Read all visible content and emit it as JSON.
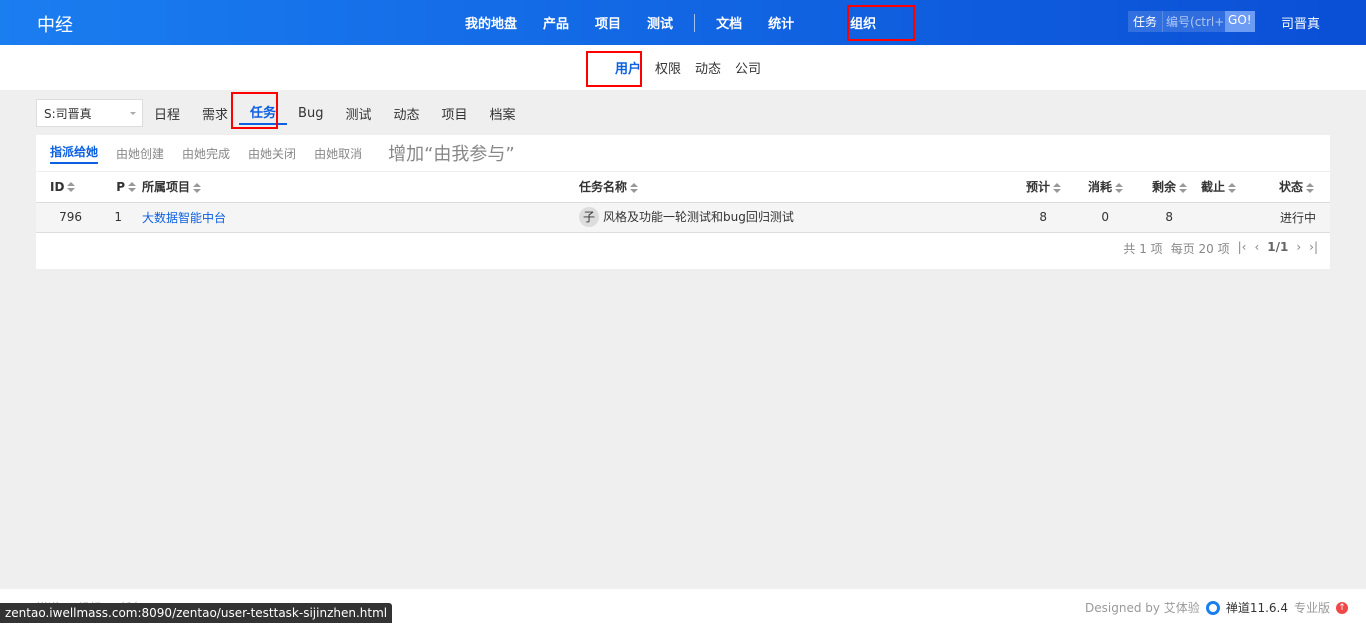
{
  "header": {
    "brand": "中经",
    "nav": [
      "我的地盘",
      "产品",
      "项目",
      "测试",
      "文档",
      "统计",
      "组织"
    ],
    "search_type": "任务",
    "search_placeholder": "编号(ctrl+g)",
    "go": "GO!",
    "user": "司晋真"
  },
  "subnav": [
    "用户",
    "权限",
    "动态",
    "公司"
  ],
  "toolbar": {
    "user_select": "S:司晋真",
    "items": [
      "日程",
      "需求",
      "任务",
      "Bug",
      "测试",
      "动态",
      "项目",
      "档案"
    ]
  },
  "tabs": [
    "指派给她",
    "由她创建",
    "由她完成",
    "由她关闭",
    "由她取消"
  ],
  "annotation": "增加“由我参与”",
  "table": {
    "headers": [
      "ID",
      "P",
      "所属项目",
      "任务名称",
      "预计",
      "消耗",
      "剩余",
      "截止",
      "状态"
    ],
    "rows": [
      {
        "id": "796",
        "p": "1",
        "project": "大数据智能中台",
        "avatar": "子",
        "name": "风格及功能一轮测试和bug回归测试",
        "est": "8",
        "consumed": "0",
        "left": "8",
        "deadline": "",
        "status": "进行中"
      }
    ]
  },
  "pager": {
    "total": "共 1 项",
    "per_page": "每页 20 项",
    "page": "1/1"
  },
  "footer": {
    "crumb": "禅道 > 组织 > 任务",
    "designed": "Designed by 艾体验",
    "version": "禅道11.6.4",
    "edition": "专业版"
  },
  "statusbar": "zentao.iwellmass.com:8090/zentao/user-testtask-sijinzhen.html"
}
